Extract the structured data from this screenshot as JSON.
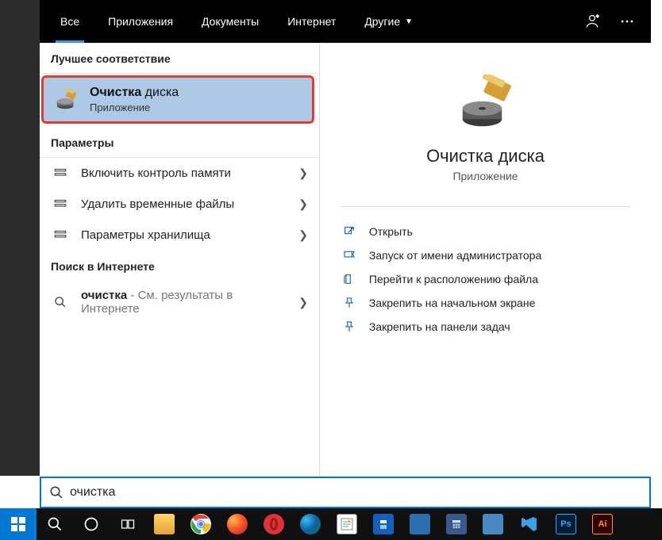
{
  "tabs": {
    "all": "Все",
    "apps": "Приложения",
    "docs": "Документы",
    "web": "Интернет",
    "more": "Другие"
  },
  "sections": {
    "best": "Лучшее соответствие",
    "params": "Параметры",
    "websearch": "Поиск в Интернете"
  },
  "best_match": {
    "title_bold": "Очистка",
    "title_rest": " диска",
    "subtitle": "Приложение"
  },
  "settings": [
    {
      "label": "Включить контроль памяти"
    },
    {
      "label": "Удалить временные файлы"
    },
    {
      "label": "Параметры хранилища"
    }
  ],
  "web_result": {
    "query_bold": "очистка",
    "suffix": " - См. результаты в Интернете"
  },
  "detail": {
    "title": "Очистка диска",
    "subtitle": "Приложение",
    "actions": [
      {
        "id": "open",
        "label": "Открыть"
      },
      {
        "id": "runas",
        "label": "Запуск от имени администратора"
      },
      {
        "id": "fileloc",
        "label": "Перейти к расположению файла"
      },
      {
        "id": "pinstart",
        "label": "Закрепить на начальном экране"
      },
      {
        "id": "pintask",
        "label": "Закрепить на панели задач"
      }
    ]
  },
  "search": {
    "value": "очистка"
  }
}
